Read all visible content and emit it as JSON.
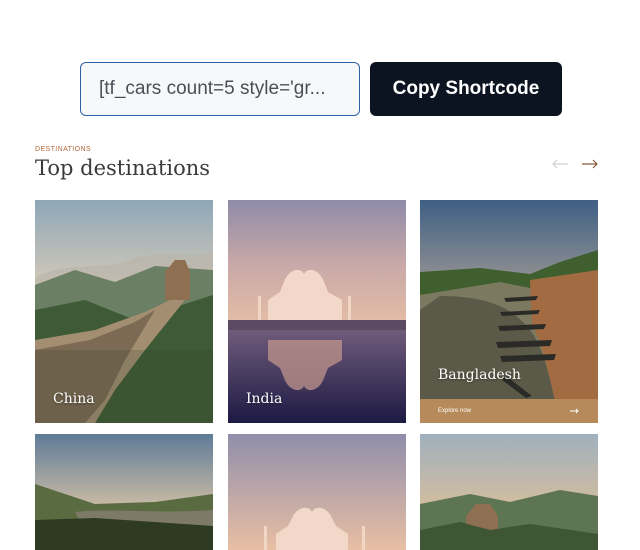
{
  "shortcode": {
    "value": "[tf_cars count=5 style='gr...",
    "copy_label": "Copy Shortcode"
  },
  "section": {
    "eyebrow": "DESTINATIONS",
    "title": "Top destinations"
  },
  "destinations": [
    {
      "name": "China"
    },
    {
      "name": "India"
    },
    {
      "name": "Bangladesh",
      "cta": "Explore now"
    }
  ],
  "icons": {
    "prev": "arrow-left-icon",
    "next": "arrow-right-icon",
    "cta": "arrow-right-icon"
  },
  "colors": {
    "accent": "#b0693a",
    "button_bg": "#0b1420",
    "input_border": "#2f5fa8",
    "cta_bar": "#b68a5a"
  }
}
